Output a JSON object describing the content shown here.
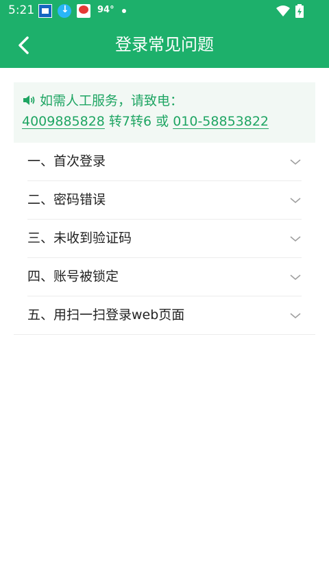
{
  "status_bar": {
    "time": "5:21",
    "temperature": "94°"
  },
  "header": {
    "title": "登录常见问题",
    "back_icon": "chevron-left-icon"
  },
  "notice": {
    "text": "如需人工服务，请致电：",
    "phone_primary": "4009885828",
    "extension_text": " 转7转6 或 ",
    "phone_secondary": "010-58853822",
    "icon": "speaker-icon"
  },
  "faq": {
    "items": [
      {
        "label": "一、首次登录"
      },
      {
        "label": "二、密码错误"
      },
      {
        "label": "三、未收到验证码"
      },
      {
        "label": "四、账号被锁定"
      },
      {
        "label": "五、用扫一扫登录web页面"
      }
    ]
  },
  "colors": {
    "brand_green": "#1db06b",
    "text_green": "#1fa563",
    "notice_bg": "#f2f8f4"
  }
}
